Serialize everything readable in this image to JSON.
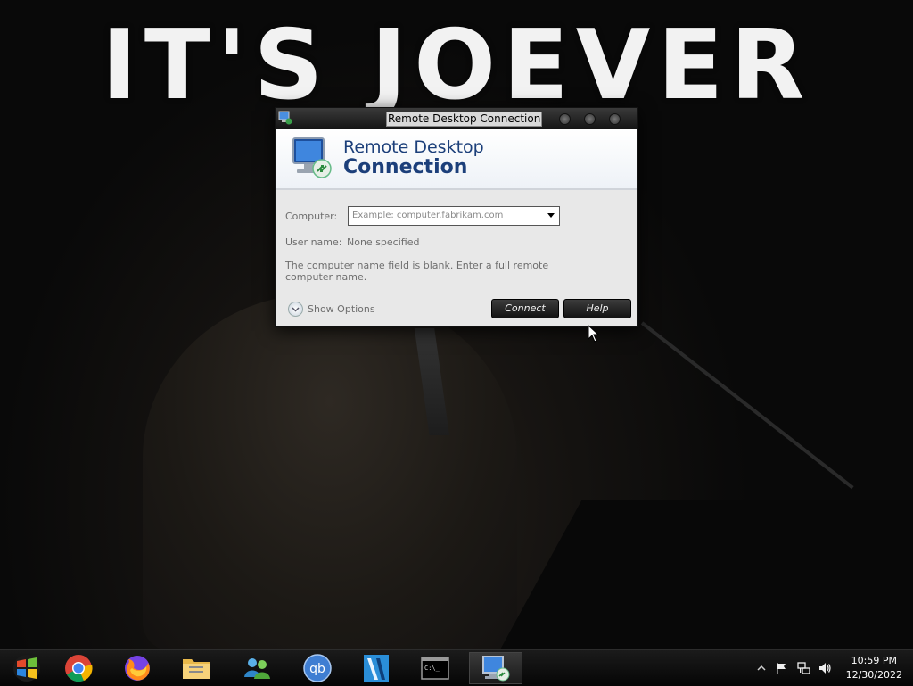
{
  "wallpaper": {
    "banner_text": "IT'S JOEVER"
  },
  "window": {
    "title": "Remote Desktop Connection",
    "header_line1": "Remote Desktop",
    "header_line2": "Connection",
    "computer_label": "Computer:",
    "computer_placeholder": "Example: computer.fabrikam.com",
    "computer_value": "",
    "username_label": "User name:",
    "username_value": "None specified",
    "message": "The computer name field is blank.  Enter a full remote computer name.",
    "show_options_label": "Show Options",
    "connect_label": "Connect",
    "help_label": "Help"
  },
  "taskbar": {
    "items": [
      {
        "name": "start-button",
        "icon": "windows-start-orb-icon"
      },
      {
        "name": "chrome",
        "icon": "chrome-icon"
      },
      {
        "name": "firefox",
        "icon": "firefox-icon"
      },
      {
        "name": "file-explorer",
        "icon": "folder-icon"
      },
      {
        "name": "messenger",
        "icon": "messenger-icon"
      },
      {
        "name": "qbittorrent",
        "icon": "qbittorrent-icon"
      },
      {
        "name": "video-editor",
        "icon": "video-app-icon"
      },
      {
        "name": "command-prompt",
        "icon": "terminal-icon"
      },
      {
        "name": "remote-desktop",
        "icon": "remote-desktop-icon",
        "active": true
      }
    ],
    "qb_text": "qb",
    "cmd_text": "C:\\_",
    "clock_time": "10:59 PM",
    "clock_date": "12/30/2022"
  },
  "colors": {
    "accent": "#1c3f7a",
    "taskbar": "#0d0d0d"
  }
}
